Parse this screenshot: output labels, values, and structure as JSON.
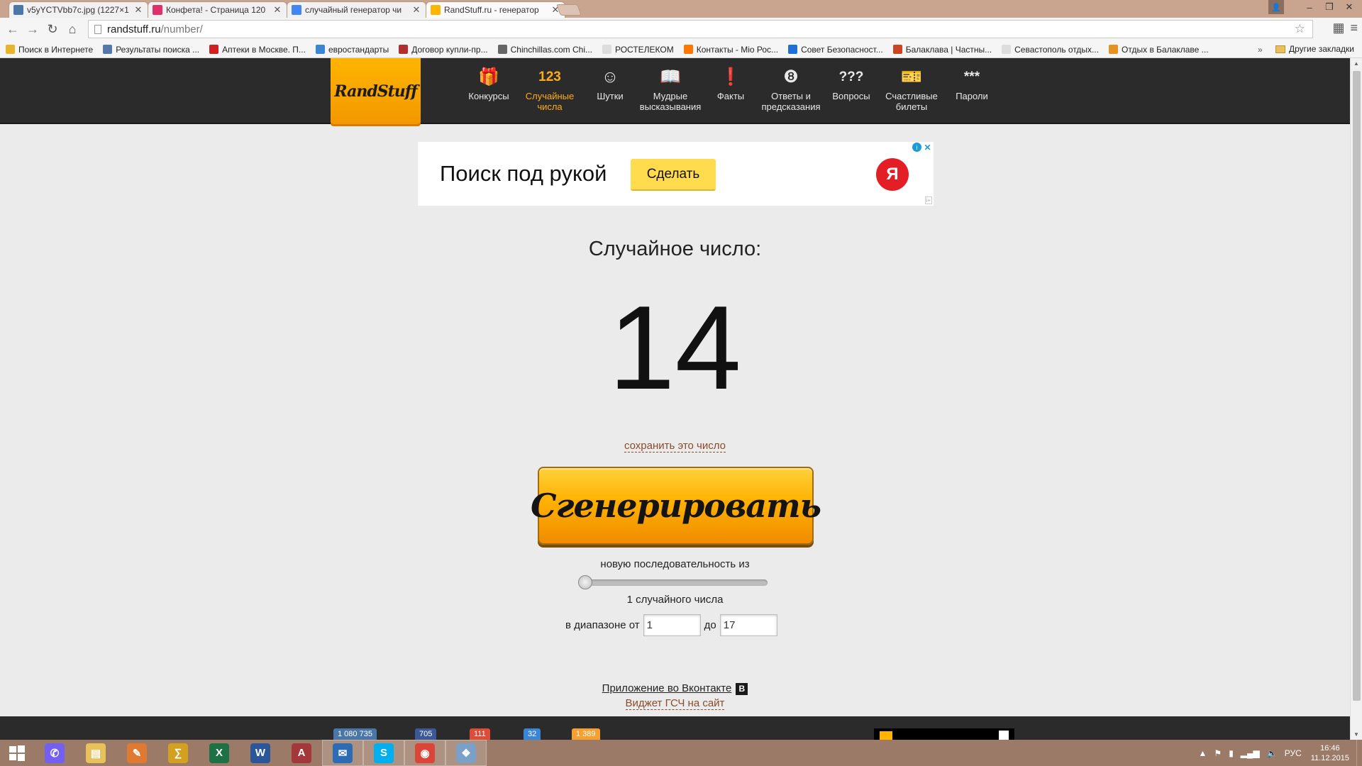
{
  "browser": {
    "tabs": [
      {
        "title": "v5yYCTVbb7c.jpg (1227×1",
        "favicon": "vk-icon",
        "color": "#4a76a8",
        "active": false
      },
      {
        "title": "Конфета! - Страница 120",
        "favicon": "konfeta-icon",
        "color": "#e0306a",
        "active": false
      },
      {
        "title": "случайный генератор чи",
        "favicon": "google-icon",
        "color": "#4285f4",
        "active": false
      },
      {
        "title": "RandStuff.ru - генератор",
        "favicon": "randstuff-icon",
        "color": "#ffb400",
        "active": true
      }
    ],
    "url": {
      "host": "randstuff.ru",
      "path": "/number/"
    },
    "bookmarks": [
      {
        "label": "Поиск в Интернете",
        "color": "#e8b52a"
      },
      {
        "label": "Результаты поиска ...",
        "color": "#5577aa"
      },
      {
        "label": "Аптеки в Москве. П...",
        "color": "#d02020"
      },
      {
        "label": "евростандарты",
        "color": "#3a86d4"
      },
      {
        "label": "Договор купли-пр...",
        "color": "#b03030"
      },
      {
        "label": "Chinchillas.com Chi...",
        "color": "#666666"
      },
      {
        "label": "РОСТЕЛЕКОМ",
        "color": "#dddddd"
      },
      {
        "label": "Контакты - Mio Рос...",
        "color": "#ff7700"
      },
      {
        "label": "Совет Безопасност...",
        "color": "#1e6fd9"
      },
      {
        "label": "Балаклава | Частны...",
        "color": "#cc4422"
      },
      {
        "label": "Севастополь отдых...",
        "color": "#dddddd"
      },
      {
        "label": "Отдых в Балаклаве ...",
        "color": "#e89020"
      }
    ],
    "other_bookmarks": "Другие закладки",
    "more": "»"
  },
  "site": {
    "logo": "RandStuff",
    "nav": [
      {
        "label": "Конкурсы",
        "icon": "gift-icon",
        "glyph": "🎁",
        "active": false
      },
      {
        "label": "Случайные числа",
        "icon": "numbers-icon",
        "glyph": "123",
        "active": true
      },
      {
        "label": "Шутки",
        "icon": "smile-icon",
        "glyph": "☺",
        "active": false
      },
      {
        "label": "Мудрые высказывания",
        "icon": "book-icon",
        "glyph": "📖",
        "active": false
      },
      {
        "label": "Факты",
        "icon": "exclamation-icon",
        "glyph": "❗",
        "active": false
      },
      {
        "label": "Ответы и предсказания",
        "icon": "eight-ball-icon",
        "glyph": "❽",
        "active": false
      },
      {
        "label": "Вопросы",
        "icon": "question-icon",
        "glyph": "???",
        "active": false
      },
      {
        "label": "Счастливые билеты",
        "icon": "ticket-icon",
        "glyph": "🎫",
        "active": false
      },
      {
        "label": "Пароли",
        "icon": "password-icon",
        "glyph": "***",
        "active": false
      }
    ]
  },
  "ad": {
    "text": "Поиск под рукой",
    "button": "Сделать",
    "logo_letter": "Я",
    "info": "i",
    "close": "✕",
    "mark": "i+"
  },
  "generator": {
    "heading": "Случайное число:",
    "result": "14",
    "save_link": "сохранить это число",
    "button": "Сгенерировать",
    "sequence_label": "новую последовательность из",
    "count": 1,
    "count_min": 1,
    "count_max": 100,
    "count_label": "1 случайного числа",
    "range_label": "в диапазоне от",
    "range_to_label": "до",
    "range_from": "1",
    "range_to": "17"
  },
  "links": {
    "vk_app": "Приложение во Вконтакте",
    "vk_badge": "В",
    "widget": "Виджет ГСЧ на сайт"
  },
  "footer": {
    "shares": [
      {
        "label": "1 080 735",
        "color": "#4a76a8"
      },
      {
        "label": "705",
        "color": "#3b5998"
      },
      {
        "label": "111",
        "color": "#dd4b39"
      },
      {
        "label": "32",
        "color": "#3a86d4"
      },
      {
        "label": "1 389",
        "color": "#f5a030"
      }
    ]
  },
  "taskbar": {
    "apps": [
      {
        "name": "viber-app",
        "color": "#7360f2",
        "glyph": "✆",
        "running": false
      },
      {
        "name": "explorer-app",
        "color": "#e8c15a",
        "glyph": "▤",
        "running": false
      },
      {
        "name": "paint-app",
        "color": "#e07a30",
        "glyph": "✎",
        "running": false
      },
      {
        "name": "calc-app",
        "color": "#d4a020",
        "glyph": "∑",
        "running": false
      },
      {
        "name": "excel-app",
        "color": "#1e7145",
        "glyph": "X",
        "running": false
      },
      {
        "name": "word-app",
        "color": "#2b579a",
        "glyph": "W",
        "running": false
      },
      {
        "name": "access-app",
        "color": "#a4373a",
        "glyph": "A",
        "running": false
      },
      {
        "name": "thunderbird-app",
        "color": "#2d6bb5",
        "glyph": "✉",
        "running": true
      },
      {
        "name": "skype-app",
        "color": "#00aff0",
        "glyph": "S",
        "running": true
      },
      {
        "name": "chrome-app",
        "color": "#db4437",
        "glyph": "◉",
        "running": true
      },
      {
        "name": "image-viewer-app",
        "color": "#7aa0c8",
        "glyph": "❖",
        "running": true
      }
    ],
    "lang": "РУС",
    "time": "16:46",
    "date": "11.12.2015"
  }
}
